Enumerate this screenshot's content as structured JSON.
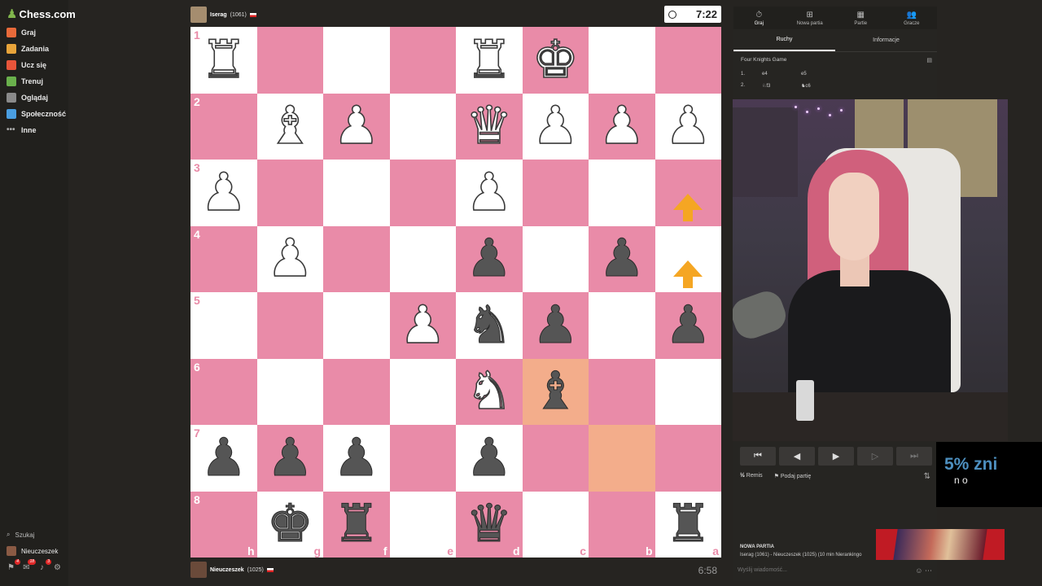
{
  "sidebar": {
    "logo": "Chess.com",
    "items": [
      {
        "label": "Graj",
        "icon": "play-icon",
        "color": "#e86a3a"
      },
      {
        "label": "Zadania",
        "icon": "puzzle-icon",
        "color": "#e8a43a"
      },
      {
        "label": "Ucz się",
        "icon": "learn-icon",
        "color": "#e8553a"
      },
      {
        "label": "Trenuj",
        "icon": "train-icon",
        "color": "#6ab04c"
      },
      {
        "label": "Oglądaj",
        "icon": "watch-icon",
        "color": "#8a8a8a"
      },
      {
        "label": "Społeczność",
        "icon": "community-icon",
        "color": "#4a9ee0"
      },
      {
        "label": "Inne",
        "icon": "more-icon",
        "color": "#aaaaaa"
      }
    ],
    "search": "Szukaj",
    "user": "Nieuczeszek",
    "badges": [
      "4",
      "18",
      "3"
    ]
  },
  "top_player": {
    "name": "Iserag",
    "rating": "(1061)",
    "clock": "7:22"
  },
  "bottom_player": {
    "name": "Nieuczeszek",
    "rating": "(1025)",
    "clock": "6:58"
  },
  "board": {
    "rank_labels": [
      "1",
      "2",
      "3",
      "4",
      "5",
      "6",
      "7",
      "8"
    ],
    "file_labels": [
      "h",
      "g",
      "f",
      "e",
      "d",
      "c",
      "b",
      "a"
    ]
  },
  "panel": {
    "tabs": [
      {
        "label": "Graj",
        "icon": "clock-icon"
      },
      {
        "label": "Nowa partia",
        "icon": "plus-icon"
      },
      {
        "label": "Partie",
        "icon": "board-icon"
      },
      {
        "label": "Gracze",
        "icon": "players-icon"
      }
    ],
    "subtabs": [
      "Ruchy",
      "Informacje"
    ],
    "opening": "Four Knights Game",
    "moves": [
      {
        "n": "1.",
        "w": "e4",
        "b": "e5"
      },
      {
        "n": "2.",
        "w": "♘f3",
        "b": "♞c6"
      }
    ]
  },
  "controls": {
    "draw": "Remis",
    "resign": "Podaj partię",
    "new_game_heading": "NOWA PARTIA",
    "new_game_detail": "Iserag (1061) - Nieuczeszek (1025) (10 min Nierankingo",
    "chat_placeholder": "Wyślij wiadomość..."
  },
  "overlay": {
    "title": "5% zni",
    "subtitle": "n o"
  }
}
